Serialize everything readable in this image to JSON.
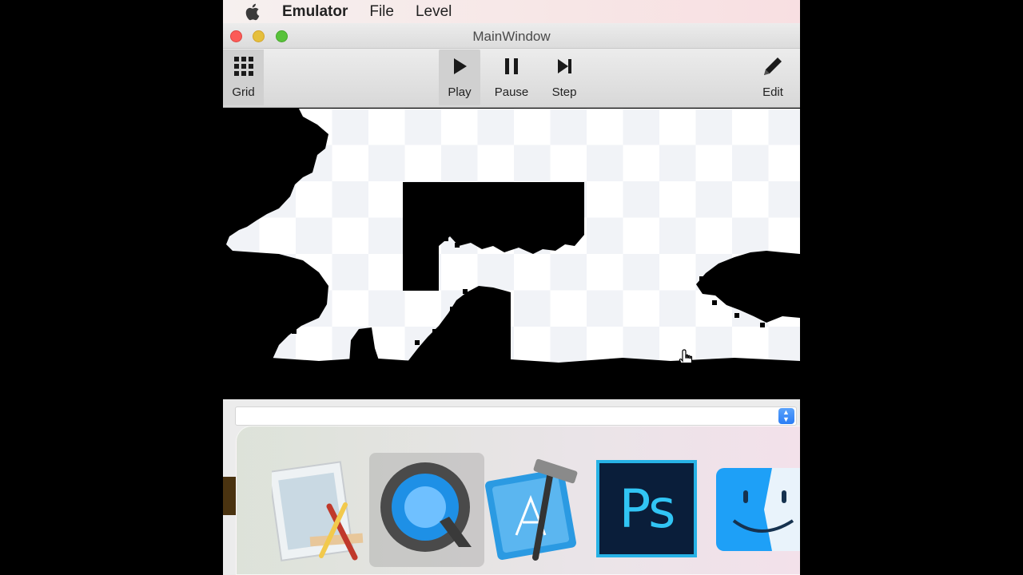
{
  "menubar": {
    "apple_icon": "apple-logo",
    "app_name": "Emulator",
    "items": [
      "File",
      "Level"
    ]
  },
  "window": {
    "title": "MainWindow",
    "traffic_lights": {
      "close": "#fc5b57",
      "minimize": "#e5bf3c",
      "zoom": "#58c23a"
    }
  },
  "toolbar": {
    "grid": {
      "label": "Grid",
      "icon": "grid-icon"
    },
    "play": {
      "label": "Play",
      "icon": "play-icon",
      "active": true
    },
    "pause": {
      "label": "Pause",
      "icon": "pause-icon"
    },
    "step": {
      "label": "Step",
      "icon": "step-icon"
    },
    "edit": {
      "label": "Edit",
      "icon": "pencil-icon"
    }
  },
  "game": {
    "background_colors": [
      "#ffffff",
      "#f1f3f7"
    ],
    "terrain_color": "#000000"
  },
  "status": {
    "field_value": "",
    "stepper_icon": "up-down-stepper-icon",
    "accent": "#2a7df5"
  },
  "dock": {
    "apps": [
      {
        "name": "Preview",
        "icon": "preview-icon"
      },
      {
        "name": "QuickTime Player",
        "icon": "quicktime-icon",
        "active": true
      },
      {
        "name": "Xcode",
        "icon": "xcode-icon"
      },
      {
        "name": "Photoshop",
        "icon": "photoshop-icon",
        "tile_text": "Ps"
      },
      {
        "name": "Finder",
        "icon": "finder-icon"
      }
    ]
  }
}
